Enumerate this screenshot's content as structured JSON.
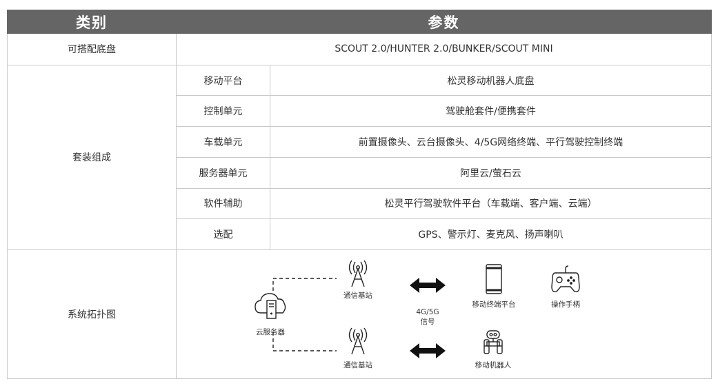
{
  "header": {
    "category": "类别",
    "params": "参数"
  },
  "rows": {
    "chassis": {
      "label": "可搭配底盘",
      "value": "SCOUT 2.0/HUNTER 2.0/BUNKER/SCOUT MINI"
    },
    "kit": {
      "label": "套装组成",
      "items": [
        {
          "label": "移动平台",
          "value": "松灵移动机器人底盘"
        },
        {
          "label": "控制单元",
          "value": "驾驶舱套件/便携套件"
        },
        {
          "label": "车载单元",
          "value": "前置摄像头、云台摄像头、4/5G网络终端、平行驾驶控制终端"
        },
        {
          "label": "服务器单元",
          "value": "阿里云/萤石云"
        },
        {
          "label": "软件辅助",
          "value": "松灵平行驾驶软件平台（车载端、客户端、云端）"
        },
        {
          "label": "选配",
          "value": "GPS、警示灯、麦克风、扬声喇叭"
        }
      ]
    },
    "topology": {
      "label": "系统拓扑图",
      "server_label": "云服务器",
      "station_top_label": "通信基站",
      "station_bottom_label": "通信基站",
      "signal_line1": "4G/5G",
      "signal_line2": "信号",
      "terminal_label": "移动终端平台",
      "gamepad_label": "操作手柄",
      "robot_label": "移动机器人"
    }
  },
  "icons": {
    "server": "cloud-server-icon",
    "station": "cell-tower-icon",
    "arrow": "double-arrow-icon",
    "terminal": "tablet-icon",
    "gamepad": "gamepad-icon",
    "robot": "robot-icon"
  },
  "colors": {
    "header_bg": "#656565",
    "header_text": "#ffffff",
    "border": "#c9c9c9",
    "icon": "#222222"
  }
}
